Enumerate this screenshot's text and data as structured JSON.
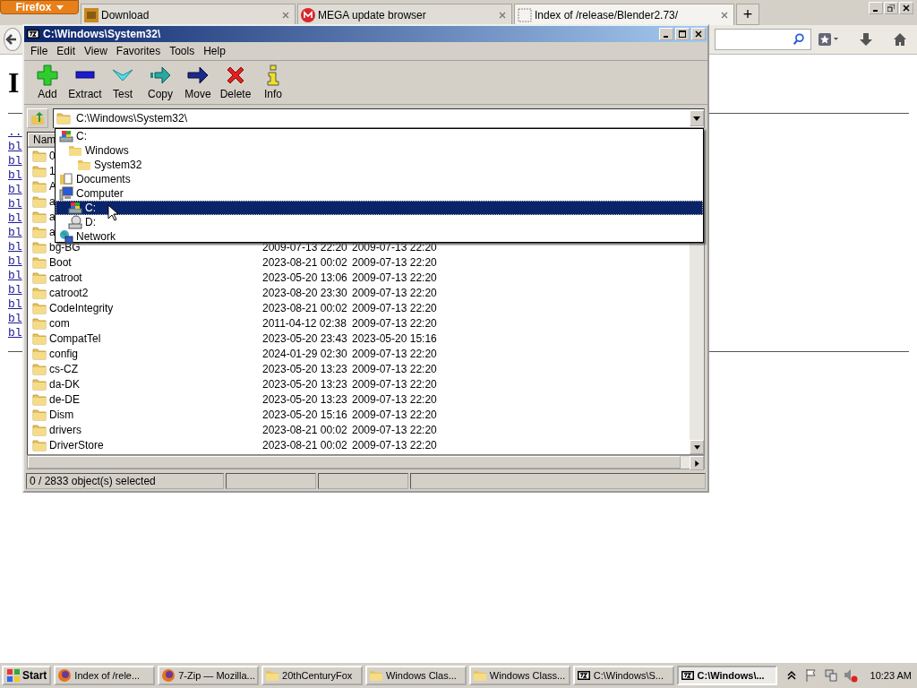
{
  "browser": {
    "menu_button": "Firefox",
    "tabs": [
      {
        "kind": "bw",
        "title": "Download",
        "selected": false
      },
      {
        "kind": "mega",
        "title": "MEGA update browser",
        "selected": false
      },
      {
        "kind": "blank",
        "title": "Index of /release/Blender2.73/",
        "selected": true
      }
    ],
    "new_tab": "+"
  },
  "page": {
    "heading": "I",
    "parent_link": "..",
    "links": [
      "bl",
      "bl",
      "bl",
      "bl",
      "bl",
      "bl",
      "bl",
      "bl",
      "bl",
      "bl",
      "bl",
      "bl",
      "bl",
      "bl"
    ]
  },
  "archiver": {
    "title": "C:\\Windows\\System32\\",
    "menu": [
      "File",
      "Edit",
      "View",
      "Favorites",
      "Tools",
      "Help"
    ],
    "toolbar": [
      {
        "kind": "add",
        "label": "Add"
      },
      {
        "kind": "extract",
        "label": "Extract"
      },
      {
        "kind": "test",
        "label": "Test"
      },
      {
        "kind": "copy",
        "label": "Copy"
      },
      {
        "kind": "move",
        "label": "Move"
      },
      {
        "kind": "delete",
        "label": "Delete"
      },
      {
        "kind": "info",
        "label": "Info"
      }
    ],
    "address": "C:\\Windows\\System32\\",
    "dropdown": [
      {
        "kind": "drive",
        "label": "C:",
        "selected": false,
        "children": [
          {
            "kind": "folder",
            "label": "Windows",
            "selected": false,
            "children": [
              {
                "kind": "folder",
                "label": "System32",
                "selected": false
              }
            ]
          }
        ]
      },
      {
        "kind": "documents",
        "label": "Documents",
        "selected": false
      },
      {
        "kind": "computer",
        "label": "Computer",
        "selected": false,
        "children": [
          {
            "kind": "drive",
            "label": "C:",
            "selected": true
          },
          {
            "kind": "disk",
            "label": "D:",
            "selected": false
          }
        ]
      },
      {
        "kind": "network",
        "label": "Network",
        "selected": false
      }
    ],
    "list": {
      "header": "Nam",
      "rows": [
        {
          "name": "0"
        },
        {
          "name": "1"
        },
        {
          "name": "A"
        },
        {
          "name": "a"
        },
        {
          "name": "a"
        },
        {
          "name": "a"
        },
        {
          "name": "bg-BG",
          "modified": "2009-07-13 22:20",
          "created": "2009-07-13 22:20"
        },
        {
          "name": "Boot",
          "modified": "2023-08-21 00:02",
          "created": "2009-07-13 22:20"
        },
        {
          "name": "catroot",
          "modified": "2023-05-20 13:06",
          "created": "2009-07-13 22:20"
        },
        {
          "name": "catroot2",
          "modified": "2023-08-20 23:30",
          "created": "2009-07-13 22:20"
        },
        {
          "name": "CodeIntegrity",
          "modified": "2023-08-21 00:02",
          "created": "2009-07-13 22:20"
        },
        {
          "name": "com",
          "modified": "2011-04-12 02:38",
          "created": "2009-07-13 22:20"
        },
        {
          "name": "CompatTel",
          "modified": "2023-05-20 23:43",
          "created": "2023-05-20 15:16"
        },
        {
          "name": "config",
          "modified": "2024-01-29 02:30",
          "created": "2009-07-13 22:20"
        },
        {
          "name": "cs-CZ",
          "modified": "2023-05-20 13:23",
          "created": "2009-07-13 22:20"
        },
        {
          "name": "da-DK",
          "modified": "2023-05-20 13:23",
          "created": "2009-07-13 22:20"
        },
        {
          "name": "de-DE",
          "modified": "2023-05-20 13:23",
          "created": "2009-07-13 22:20"
        },
        {
          "name": "Dism",
          "modified": "2023-05-20 15:16",
          "created": "2009-07-13 22:20"
        },
        {
          "name": "drivers",
          "modified": "2023-08-21 00:02",
          "created": "2009-07-13 22:20"
        },
        {
          "name": "DriverStore",
          "modified": "2023-08-21 00:02",
          "created": "2009-07-13 22:20"
        }
      ]
    },
    "status": "0 / 2833 object(s) selected"
  },
  "taskbar": {
    "start": "Start",
    "items": [
      {
        "kind": "firefox",
        "label": "Index of /rele...",
        "selected": false
      },
      {
        "kind": "firefox",
        "label": "7-Zip — Mozilla...",
        "selected": false
      },
      {
        "kind": "folder",
        "label": "20thCenturyFox",
        "selected": false
      },
      {
        "kind": "folder",
        "label": "Windows Clas...",
        "selected": false
      },
      {
        "kind": "folder",
        "label": "Windows Class...",
        "selected": false
      },
      {
        "kind": "sevenzip",
        "label": "C:\\Windows\\S...",
        "selected": false
      },
      {
        "kind": "sevenzip",
        "label": "C:\\Windows\\...",
        "selected": true
      }
    ],
    "clock": "10:23 AM"
  }
}
